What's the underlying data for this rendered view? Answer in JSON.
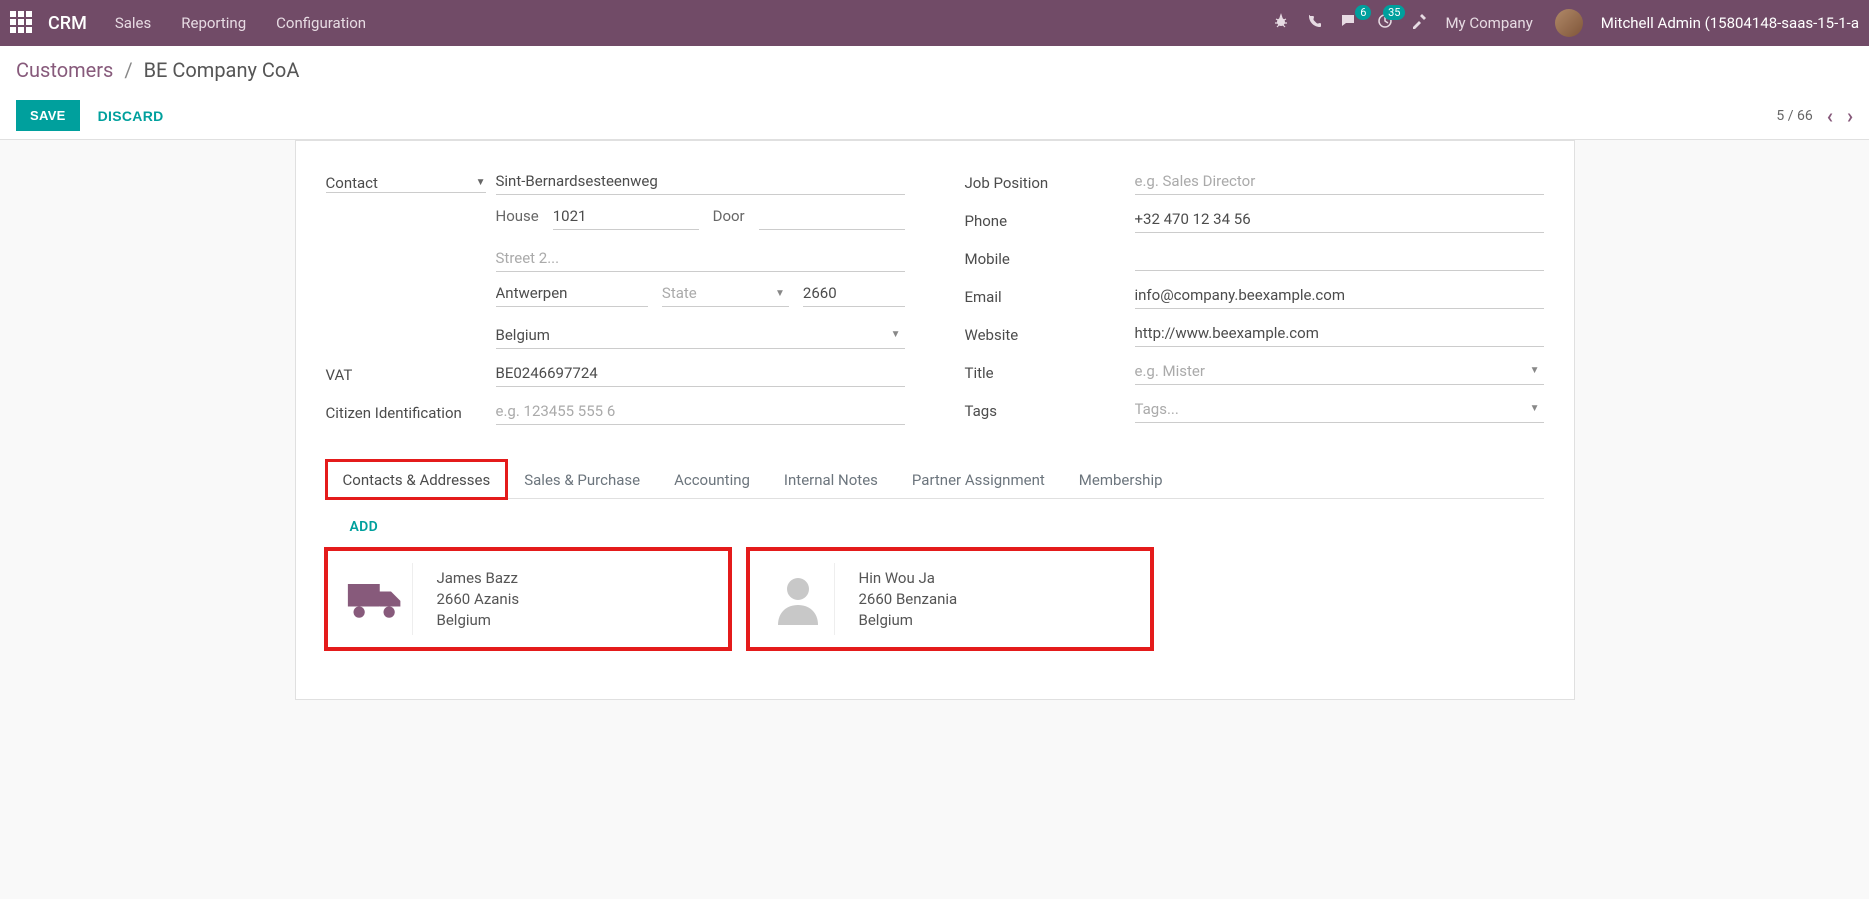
{
  "topbar": {
    "brand": "CRM",
    "nav": {
      "sales": "Sales",
      "reporting": "Reporting",
      "configuration": "Configuration"
    },
    "badges": {
      "messages": "6",
      "activities": "35"
    },
    "company": "My Company",
    "user": "Mitchell Admin (15804148-saas-15-1-a"
  },
  "header": {
    "breadcrumb_root": "Customers",
    "breadcrumb_current": "BE Company CoA",
    "save": "SAVE",
    "discard": "DISCARD",
    "pager_text": "5 / 66"
  },
  "form": {
    "contact_type": {
      "label": "Contact"
    },
    "address": {
      "street": "Sint-Bernardsesteenweg",
      "house_label": "House",
      "house": "1021",
      "door_label": "Door",
      "door": "",
      "street2_placeholder": "Street 2...",
      "city": "Antwerpen",
      "state_placeholder": "State",
      "zip": "2660",
      "country": "Belgium"
    },
    "vat": {
      "label": "VAT",
      "value": "BE0246697724"
    },
    "citizen": {
      "label": "Citizen Identification",
      "placeholder": "e.g. 123455 555 6",
      "value": ""
    },
    "job": {
      "label": "Job Position",
      "placeholder": "e.g. Sales Director",
      "value": ""
    },
    "phone": {
      "label": "Phone",
      "value": "+32 470 12 34 56"
    },
    "mobile": {
      "label": "Mobile",
      "value": ""
    },
    "email": {
      "label": "Email",
      "value": "info@company.beexample.com"
    },
    "website": {
      "label": "Website",
      "value": "http://www.beexample.com"
    },
    "title": {
      "label": "Title",
      "placeholder": "e.g. Mister",
      "value": ""
    },
    "tags": {
      "label": "Tags",
      "placeholder": "Tags...",
      "value": ""
    }
  },
  "tabs": {
    "contacts": "Contacts & Addresses",
    "sales": "Sales & Purchase",
    "accounting": "Accounting",
    "notes": "Internal Notes",
    "partner": "Partner Assignment",
    "membership": "Membership"
  },
  "contacts_tab": {
    "add": "ADD",
    "cards": [
      {
        "name": "James Bazz",
        "line2": "2660 Azanis",
        "line3": "Belgium",
        "icon": "truck"
      },
      {
        "name": "Hin Wou Ja",
        "line2": "2660 Benzania",
        "line3": "Belgium",
        "icon": "person"
      }
    ]
  }
}
